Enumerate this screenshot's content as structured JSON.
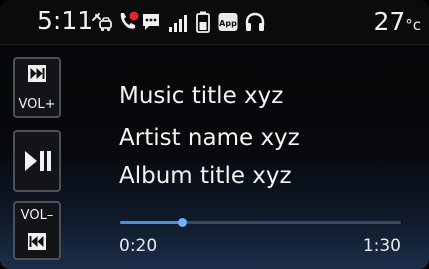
{
  "status_bar": {
    "time": "5:11",
    "temperature": "27",
    "temperature_unit": "°c",
    "icons": [
      "car-phone-icon",
      "missed-call-icon",
      "message-icon",
      "signal-icon",
      "battery-icon",
      "app-icon",
      "headphones-icon"
    ],
    "app_badge_label": "App"
  },
  "controls": {
    "vol_up_label": "VOL+",
    "vol_down_label": "VOL–",
    "next_icon": "skip-forward-icon",
    "play_pause_icon": "play-pause-icon",
    "prev_icon": "skip-back-icon"
  },
  "track": {
    "title": "Music title xyz",
    "artist": "Artist name xyz",
    "album": "Album title xyz"
  },
  "progress": {
    "elapsed": "0:20",
    "total": "1:30",
    "fraction": 0.222
  },
  "colors": {
    "accent": "#4a8fe6",
    "missed_call": "#e0262b",
    "background": "#07090c"
  }
}
